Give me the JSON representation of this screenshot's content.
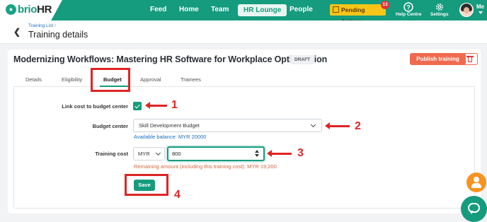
{
  "brand": {
    "logo_prefix": "brio",
    "logo_suffix": "HR",
    "accent": "#159b7e"
  },
  "nav": {
    "items": [
      "Feed",
      "Home",
      "Team",
      "HR Lounge",
      "People"
    ],
    "active": "HR Lounge",
    "pending_label": "Pending Actions",
    "pending_count": "13",
    "help_label": "Help Centre",
    "settings_label": "Settings",
    "user_label": "Me"
  },
  "header": {
    "breadcrumb_link": "Training List",
    "breadcrumb_sep": "/",
    "title": "Training details"
  },
  "training": {
    "title": "Modernizing Workflows: Mastering HR Software for Workplace Optimization",
    "status": "DRAFT",
    "publish_label": "Publish training"
  },
  "tabs": [
    "Details",
    "Eligibility",
    "Budget",
    "Approval",
    "Trainees"
  ],
  "active_tab": "Budget",
  "form": {
    "link_label": "Link cost to budget center",
    "link_checked": true,
    "budget_center_label": "Budget center",
    "budget_center_value": "Skill Development Budget",
    "available_balance": "Available balance: MYR 20000",
    "training_cost_label": "Training cost",
    "currency": "MYR",
    "cost_value": "800",
    "remaining": "Remaining amount (including this training cost): MYR 19,200",
    "save_label": "Save"
  },
  "annotations": [
    "1",
    "2",
    "3",
    "4"
  ]
}
